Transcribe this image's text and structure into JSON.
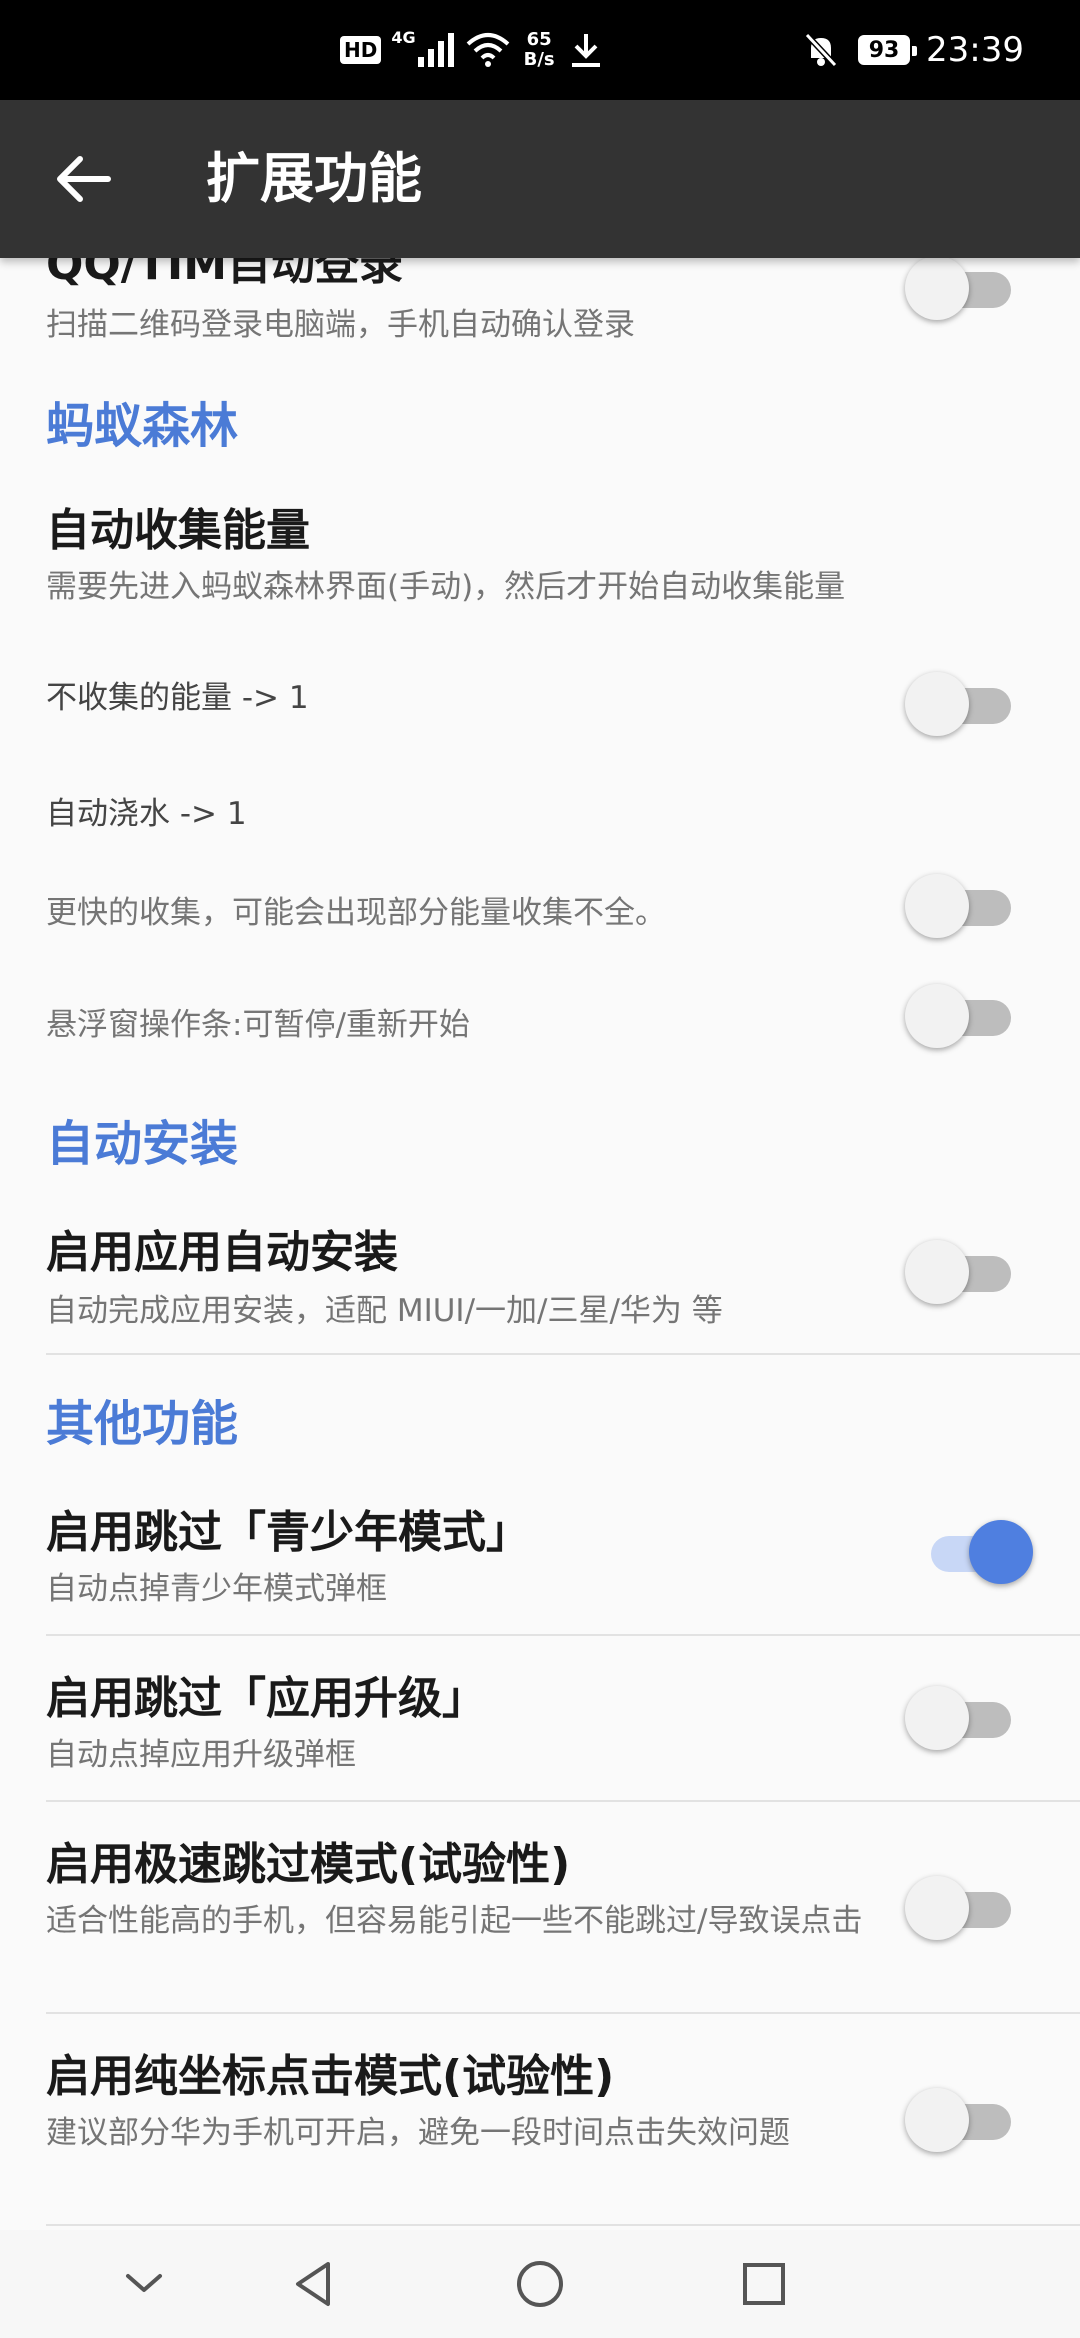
{
  "status_bar": {
    "hd": "HD",
    "network_type": "4G",
    "speed_value": "65",
    "speed_unit": "B/s",
    "battery": "93",
    "time": "23:39",
    "icons": [
      "signal-icon",
      "wifi-icon",
      "download-icon",
      "bell-muted-icon",
      "battery-icon"
    ]
  },
  "app_bar": {
    "title": "扩展功能",
    "back_icon": "arrow-left-icon"
  },
  "items": {
    "qq_login": {
      "title": "QQ/TIM自动登录",
      "summary": "扫描二维码登录电脑端，手机自动确认登录",
      "enabled": false
    },
    "ant_forest_header": "蚂蚁森林",
    "auto_collect": {
      "title": "自动收集能量",
      "summary": "需要先进入蚂蚁森林界面(手动)，然后才开始自动收集能量",
      "extra": "不收集的能量 -> 1",
      "enabled": false
    },
    "auto_water": {
      "summary": "自动浇水 -> 1"
    },
    "fast_collect": {
      "summary": "更快的收集，可能会出现部分能量收集不全。",
      "enabled": false
    },
    "float_bar": {
      "summary": "悬浮窗操作条:可暂停/重新开始",
      "enabled": false
    },
    "auto_install_header": "自动安装",
    "auto_install": {
      "title": "启用应用自动安装",
      "summary": "自动完成应用安装，适配 MIUI/一加/三星/华为 等",
      "enabled": false
    },
    "other_header": "其他功能",
    "skip_teen": {
      "title": "启用跳过「青少年模式」",
      "summary": "自动点掉青少年模式弹框",
      "enabled": true
    },
    "skip_upgrade": {
      "title": "启用跳过「应用升级」",
      "summary": "自动点掉应用升级弹框",
      "enabled": false
    },
    "fast_skip": {
      "title": "启用极速跳过模式(试验性)",
      "summary": "适合性能高的手机，但容易能引起一些不能跳过/导致误点击",
      "enabled": false
    },
    "coord_click": {
      "title": "启用纯坐标点击模式(试验性)",
      "summary": "建议部分华为手机可开启，避免一段时间点击失效问题",
      "enabled": false
    }
  },
  "nav_bar": {
    "icons": [
      "chevron-down-icon",
      "back-triangle-icon",
      "home-circle-icon",
      "recents-square-icon"
    ]
  },
  "colors": {
    "accent": "#4f7fe0",
    "category": "#4b7bd6",
    "app_bar": "#333333"
  }
}
